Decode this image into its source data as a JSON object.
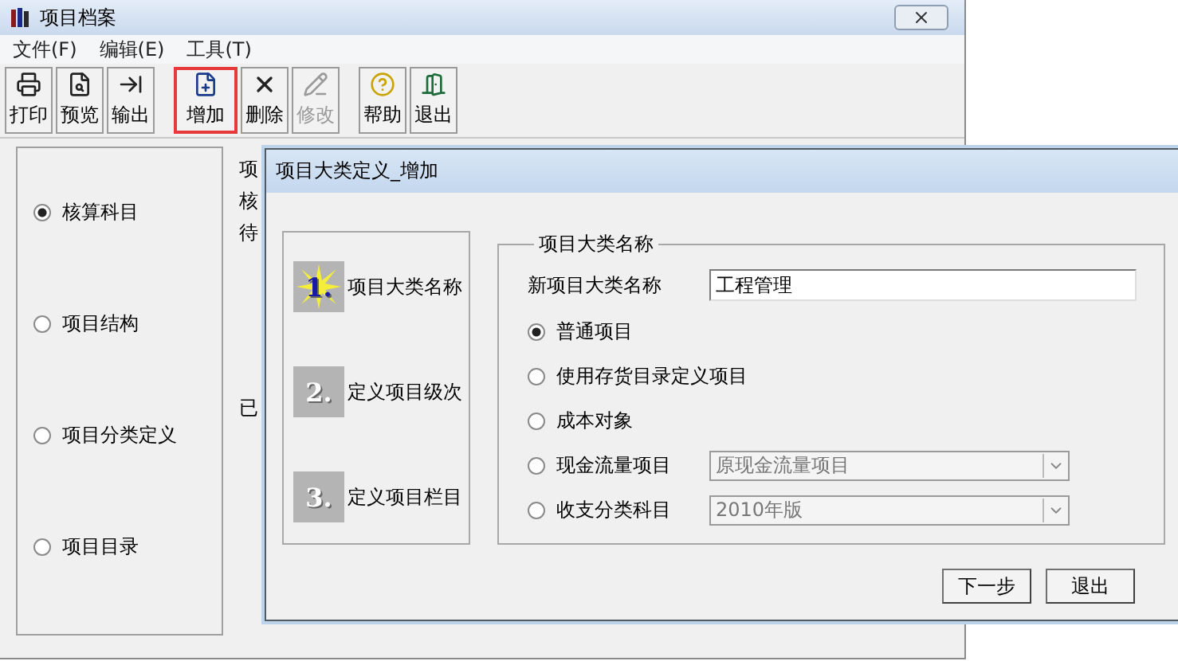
{
  "window": {
    "title": "项目档案"
  },
  "menu": [
    "文件(F)",
    "编辑(E)",
    "工具(T)"
  ],
  "toolbar": [
    {
      "label": "打印",
      "disabled": false,
      "highlighted": false
    },
    {
      "label": "预览",
      "disabled": false,
      "highlighted": false
    },
    {
      "label": "输出",
      "disabled": false,
      "highlighted": false
    },
    {
      "label": "增加",
      "disabled": false,
      "highlighted": true
    },
    {
      "label": "删除",
      "disabled": false,
      "highlighted": false
    },
    {
      "label": "修改",
      "disabled": true,
      "highlighted": false
    },
    {
      "label": "帮助",
      "disabled": false,
      "highlighted": false
    },
    {
      "label": "退出",
      "disabled": false,
      "highlighted": false
    }
  ],
  "nav": [
    {
      "label": "核算科目",
      "selected": true
    },
    {
      "label": "项目结构",
      "selected": false
    },
    {
      "label": "项目分类定义",
      "selected": false
    },
    {
      "label": "项目目录",
      "selected": false
    }
  ],
  "behind_texts": [
    "项",
    "核",
    "待",
    "已"
  ],
  "dialog": {
    "title": "项目大类定义_增加",
    "steps": [
      {
        "number": "1.",
        "label": "项目大类名称",
        "selected": true
      },
      {
        "number": "2.",
        "label": "定义项目级次",
        "selected": false
      },
      {
        "number": "3.",
        "label": "定义项目栏目",
        "selected": false
      }
    ],
    "group_title": "项目大类名称",
    "name_field": {
      "label": "新项目大类名称",
      "value": "工程管理"
    },
    "options": [
      {
        "label": "普通项目",
        "selected": true
      },
      {
        "label": "使用存货目录定义项目",
        "selected": false
      },
      {
        "label": "成本对象",
        "selected": false
      },
      {
        "label": "现金流量项目",
        "selected": false,
        "dropdown": {
          "value": "原现金流量项目",
          "disabled": true
        }
      },
      {
        "label": "收支分类科目",
        "selected": false,
        "dropdown": {
          "value": "2010年版",
          "disabled": true
        }
      }
    ],
    "buttons": [
      "下一步",
      "退出"
    ]
  }
}
